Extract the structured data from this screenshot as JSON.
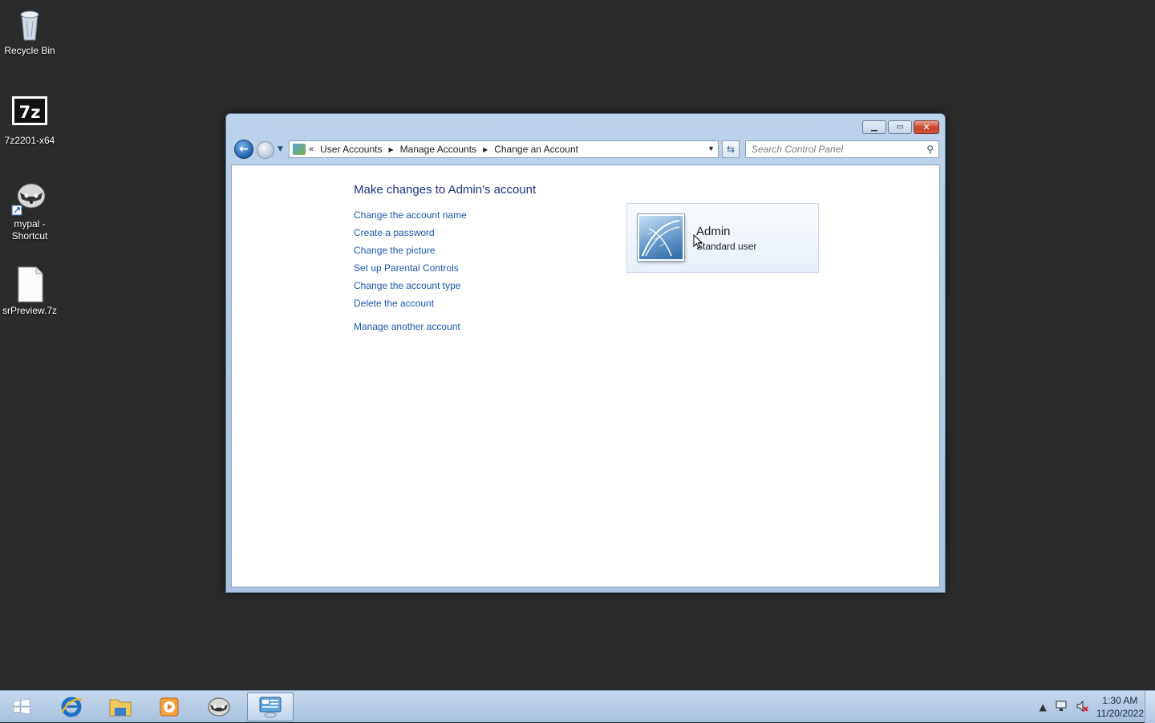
{
  "desktop": {
    "icons": [
      {
        "label": "Recycle Bin",
        "icon": "recycle-bin-icon"
      },
      {
        "label": "7z2201-x64",
        "icon": "7zip-icon"
      },
      {
        "label": "mypal - Shortcut",
        "icon": "mypal-shortcut-icon"
      },
      {
        "label": "srPreview.7z",
        "icon": "file-icon"
      }
    ]
  },
  "window": {
    "breadcrumb": {
      "overflow": "«",
      "items": [
        "User Accounts",
        "Manage Accounts",
        "Change an Account"
      ]
    },
    "search": {
      "placeholder": "Search Control Panel"
    },
    "page_title": "Make changes to Admin's account",
    "links": [
      "Change the account name",
      "Create a password",
      "Change the picture",
      "Set up Parental Controls",
      "Change the account type",
      "Delete the account"
    ],
    "manage_other": "Manage another account",
    "account": {
      "name": "Admin",
      "type": "Standard user"
    }
  },
  "taskbar": {
    "apps": [
      "start-icon",
      "internet-explorer-icon",
      "file-explorer-icon",
      "media-player-icon",
      "mypal-icon",
      "control-panel-icon"
    ],
    "clock": {
      "time": "1:30 AM",
      "date": "11/20/2022"
    }
  },
  "colors": {
    "desktop_bg": "#2b2b2b",
    "link": "#1b57b1",
    "title": "#1e3287"
  }
}
